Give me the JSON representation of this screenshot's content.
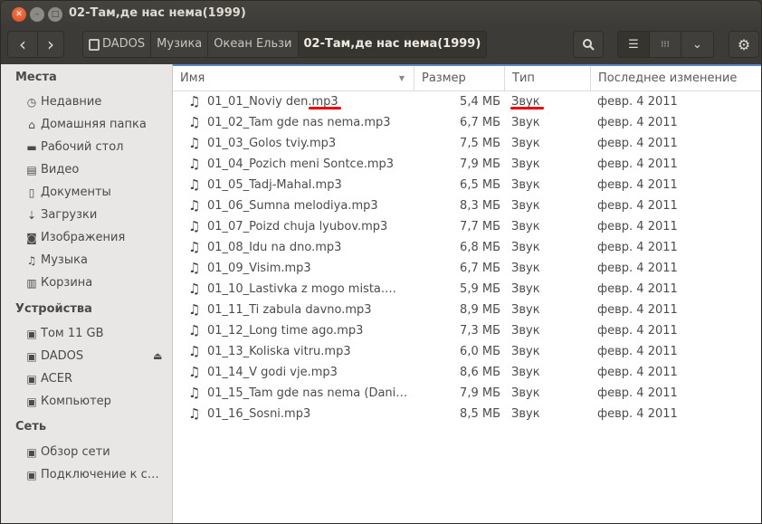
{
  "window": {
    "title": "02-Там,де нас нема(1999)"
  },
  "toolbar": {
    "back": "‹",
    "forward": "›",
    "breadcrumbs": [
      "DADOS",
      "Музика",
      "Океан Ельзи",
      "02-Там,де нас нема(1999)"
    ]
  },
  "sidebar": {
    "places_heading": "Места",
    "places": [
      {
        "label": "Недавние",
        "icon": "clock-icon"
      },
      {
        "label": "Домашняя папка",
        "icon": "home-icon"
      },
      {
        "label": "Рабочий стол",
        "icon": "folder-icon"
      },
      {
        "label": "Видео",
        "icon": "film-icon"
      },
      {
        "label": "Документы",
        "icon": "document-icon"
      },
      {
        "label": "Загрузки",
        "icon": "download-icon"
      },
      {
        "label": "Изображения",
        "icon": "camera-icon"
      },
      {
        "label": "Музыка",
        "icon": "music-icon"
      },
      {
        "label": "Корзина",
        "icon": "trash-icon"
      }
    ],
    "devices_heading": "Устройства",
    "devices": [
      {
        "label": "Том 11 GB"
      },
      {
        "label": "DADOS"
      },
      {
        "label": "ACER"
      },
      {
        "label": "Компьютер"
      }
    ],
    "network_heading": "Сеть",
    "network": [
      {
        "label": "Обзор сети"
      },
      {
        "label": "Подключение к с…"
      }
    ]
  },
  "columns": {
    "name": "Имя",
    "size": "Размер",
    "type": "Тип",
    "modified": "Последнее изменение"
  },
  "files": [
    {
      "name": "01_01_Noviy den.mp3",
      "size": "5,4 МБ",
      "type": "Звук",
      "modified": "февр. 4 2011"
    },
    {
      "name": "01_02_Tam gde nas nema.mp3",
      "size": "6,7 МБ",
      "type": "Звук",
      "modified": "февр. 4 2011"
    },
    {
      "name": "01_03_Golos tviy.mp3",
      "size": "7,5 МБ",
      "type": "Звук",
      "modified": "февр. 4 2011"
    },
    {
      "name": "01_04_Pozich meni Sontce.mp3",
      "size": "7,9 МБ",
      "type": "Звук",
      "modified": "февр. 4 2011"
    },
    {
      "name": "01_05_Tadj-Mahal.mp3",
      "size": "6,5 МБ",
      "type": "Звук",
      "modified": "февр. 4 2011"
    },
    {
      "name": "01_06_Sumna melodiya.mp3",
      "size": "8,3 МБ",
      "type": "Звук",
      "modified": "февр. 4 2011"
    },
    {
      "name": "01_07_Poizd chuja lyubov.mp3",
      "size": "7,7 МБ",
      "type": "Звук",
      "modified": "февр. 4 2011"
    },
    {
      "name": "01_08_Idu na dno.mp3",
      "size": "6,8 МБ",
      "type": "Звук",
      "modified": "февр. 4 2011"
    },
    {
      "name": "01_09_Visim.mp3",
      "size": "6,7 МБ",
      "type": "Звук",
      "modified": "февр. 4 2011"
    },
    {
      "name": "01_10_Lastivka z mogo mista.…",
      "size": "5,9 МБ",
      "type": "Звук",
      "modified": "февр. 4 2011"
    },
    {
      "name": "01_11_Ti zabula davno.mp3",
      "size": "8,9 МБ",
      "type": "Звук",
      "modified": "февр. 4 2011"
    },
    {
      "name": "01_12_Long time ago.mp3",
      "size": "7,3 МБ",
      "type": "Звук",
      "modified": "февр. 4 2011"
    },
    {
      "name": "01_13_Koliska vitru.mp3",
      "size": "6,0 МБ",
      "type": "Звук",
      "modified": "февр. 4 2011"
    },
    {
      "name": "01_14_V godi vje.mp3",
      "size": "8,6 МБ",
      "type": "Звук",
      "modified": "февр. 4 2011"
    },
    {
      "name": "01_15_Tam gde nas nema (Dani…",
      "size": "7,9 МБ",
      "type": "Звук",
      "modified": "февр. 4 2011"
    },
    {
      "name": "01_16_Sosni.mp3",
      "size": "8,5 МБ",
      "type": "Звук",
      "modified": "февр. 4 2011"
    }
  ],
  "colors": {
    "annotation": "#e00000",
    "accent": "#5a88c6",
    "close": "#df4a16"
  }
}
